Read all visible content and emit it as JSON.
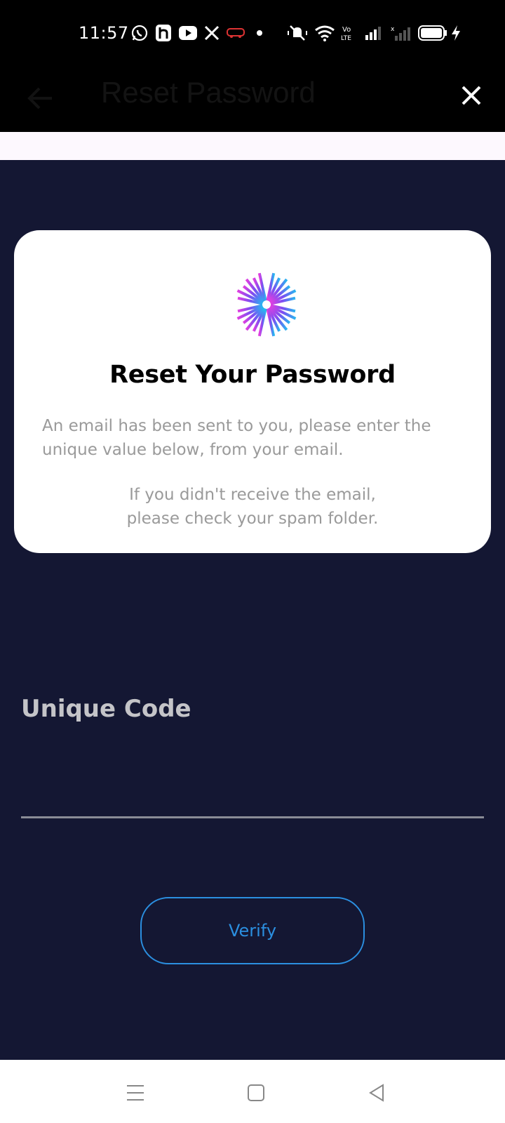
{
  "status_bar": {
    "time": "11:57",
    "icons": [
      "whatsapp-icon",
      "h-app-icon",
      "youtube-icon",
      "x-icon",
      "bus-icon",
      "dot-icon",
      "mute-vibrate-icon",
      "wifi-icon",
      "volte-icon",
      "signal-icon",
      "signal-2-icon",
      "battery-icon",
      "charging-icon"
    ]
  },
  "app_bar": {
    "title": "Reset Password",
    "back_icon": "back-arrow-icon",
    "close_icon": "close-icon"
  },
  "card": {
    "title": "Reset Your Password",
    "description": "An email has been sent to you, please enter the unique value below, from your email.",
    "note_line1": "If you didn't receive the email,",
    "note_line2": "please check your spam folder."
  },
  "form": {
    "code_label": "Unique Code",
    "code_value": "",
    "verify_label": "Verify"
  },
  "nav_bar": {
    "icons": [
      "menu-icon",
      "home-icon",
      "back-icon"
    ]
  },
  "colors": {
    "background": "#141733",
    "accent": "#2b8fe0",
    "card": "#ffffff"
  }
}
